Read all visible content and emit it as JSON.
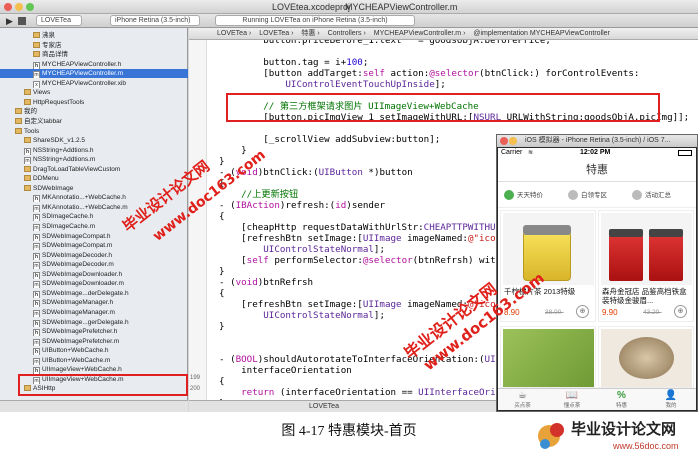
{
  "xcode": {
    "tab_project": "LOVETea",
    "scheme_device": "iPhone Retina (3.5-inch)",
    "status_text": "Running LOVETea on iPhone Retina (3.5-inch)",
    "window_title_1": "LOVEtea.xcodeproj",
    "window_title_2": "MYCHEAPViewController.m",
    "breadcrumb": [
      "LOVETea",
      "LOVETea",
      "特惠",
      "Controllers",
      "MYCHEAPViewController.m",
      "@implementation MYCHEAPViewController"
    ],
    "status_bar_label": "LOVETea"
  },
  "navigator": {
    "items": [
      {
        "label": "沸泉",
        "type": "folder",
        "indent": 3
      },
      {
        "label": "专家店",
        "type": "folder",
        "indent": 3
      },
      {
        "label": "商品详情",
        "type": "folder",
        "indent": 3
      },
      {
        "label": "MYCHEAPViewController.h",
        "type": "h",
        "indent": 3
      },
      {
        "label": "MYCHEAPViewController.m",
        "type": "m",
        "indent": 3,
        "selected": true
      },
      {
        "label": "MYCHEAPViewController.xib",
        "type": "x",
        "indent": 3
      },
      {
        "label": "Views",
        "type": "folder",
        "indent": 2
      },
      {
        "label": "HttpRequestTools",
        "type": "folder",
        "indent": 2
      },
      {
        "label": "我的",
        "type": "folder",
        "indent": 1
      },
      {
        "label": "自定义tabbar",
        "type": "folder",
        "indent": 1
      },
      {
        "label": "Tools",
        "type": "folder",
        "indent": 1
      },
      {
        "label": "ShareSDK_v1.2.5",
        "type": "folder",
        "indent": 2
      },
      {
        "label": "NSString+Addtions.h",
        "type": "h",
        "indent": 2
      },
      {
        "label": "NSString+Addtions.m",
        "type": "m",
        "indent": 2
      },
      {
        "label": "DragToLoadTableViewCustom",
        "type": "folder",
        "indent": 2
      },
      {
        "label": "DDMenu",
        "type": "folder",
        "indent": 2
      },
      {
        "label": "SDWebImage",
        "type": "folder",
        "indent": 2
      },
      {
        "label": "MKAnnotatio...+WebCache.h",
        "type": "h",
        "indent": 3
      },
      {
        "label": "MKAnnotatio...+WebCache.m",
        "type": "m",
        "indent": 3
      },
      {
        "label": "SDImageCache.h",
        "type": "h",
        "indent": 3
      },
      {
        "label": "SDImageCache.m",
        "type": "m",
        "indent": 3
      },
      {
        "label": "SDWebImageCompat.h",
        "type": "h",
        "indent": 3
      },
      {
        "label": "SDWebImageCompat.m",
        "type": "m",
        "indent": 3
      },
      {
        "label": "SDWebImageDecoder.h",
        "type": "h",
        "indent": 3
      },
      {
        "label": "SDWebImageDecoder.m",
        "type": "m",
        "indent": 3
      },
      {
        "label": "SDWebImageDownloader.h",
        "type": "h",
        "indent": 3
      },
      {
        "label": "SDWebImageDownloader.m",
        "type": "m",
        "indent": 3
      },
      {
        "label": "SDWebImage...derDelegate.h",
        "type": "h",
        "indent": 3
      },
      {
        "label": "SDWebImageManager.h",
        "type": "h",
        "indent": 3
      },
      {
        "label": "SDWebImageManager.m",
        "type": "m",
        "indent": 3
      },
      {
        "label": "SDWebImage...gerDelegate.h",
        "type": "h",
        "indent": 3
      },
      {
        "label": "SDWebImagePrefetcher.h",
        "type": "h",
        "indent": 3
      },
      {
        "label": "SDWebImagePrefetcher.m",
        "type": "m",
        "indent": 3
      },
      {
        "label": "UIButton+WebCache.h",
        "type": "h",
        "indent": 3
      },
      {
        "label": "UIButton+WebCache.m",
        "type": "m",
        "indent": 3
      },
      {
        "label": "UIImageView+WebCache.h",
        "type": "h",
        "indent": 3
      },
      {
        "label": "UIImageView+WebCache.m",
        "type": "m",
        "indent": 3
      },
      {
        "label": "ASIHttp",
        "type": "folder",
        "indent": 2
      }
    ]
  },
  "code": {
    "lines": [
      {
        "n": "",
        "t": "        button.priceBefore_1.text   = goodsObjA.beforePrice;"
      },
      {
        "n": "",
        "t": ""
      },
      {
        "n": "",
        "t": "        button.tag = i+100;"
      },
      {
        "n": "",
        "t": "        [button addTarget:self action:@selector(btnClick:) forControlEvents:"
      },
      {
        "n": "",
        "t": "            UIControlEventTouchUpInside];"
      },
      {
        "n": "",
        "t": ""
      },
      {
        "n": "",
        "t": "        // 第三方框架请求图片 UIImageView+WebCache"
      },
      {
        "n": "",
        "t": "        [button.picImgView_1 setImageWithURL:[NSURL URLWithString:goodsObjA.picImg]];"
      },
      {
        "n": "",
        "t": ""
      },
      {
        "n": "",
        "t": "        [_scrollView addSubview:button];"
      },
      {
        "n": "",
        "t": "    }"
      },
      {
        "n": "",
        "t": "}"
      },
      {
        "n": "",
        "t": "- (void)btnClick:(UIButton *)button"
      },
      {
        "n": "",
        "t": "{"
      },
      {
        "n": "",
        "t": "    //上更新按钮"
      },
      {
        "n": "",
        "t": "- (IBAction)refresh:(id)sender"
      },
      {
        "n": "",
        "t": "{"
      },
      {
        "n": "",
        "t": "    [cheapHttp requestDataWithUrlStr:CHEAPTTPWITHURL];"
      },
      {
        "n": "",
        "t": "    [refreshBtn setImage:[UIImage imageNamed:@\"icon_update_nor\"] forState:"
      },
      {
        "n": "",
        "t": "        UIControlStateNormal];"
      },
      {
        "n": "",
        "t": "    [self performSelector:@selector(btnRefrsh) withObject:nil afterDelay:1];"
      },
      {
        "n": "",
        "t": "}"
      },
      {
        "n": "",
        "t": "- (void)btnRefrsh"
      },
      {
        "n": "",
        "t": "{"
      },
      {
        "n": "",
        "t": "    [refreshBtn setImage:[UIImage imageNamed:@\"icon_update\"] forState:"
      },
      {
        "n": "",
        "t": "        UIControlStateNormal];"
      },
      {
        "n": "",
        "t": "}"
      },
      {
        "n": "",
        "t": ""
      },
      {
        "n": "",
        "t": ""
      },
      {
        "n": "",
        "t": "- (BOOL)shouldAutorotateToInterfaceOrientation:(UIInterfaceOrientation)"
      },
      {
        "n": "",
        "t": "    interfaceOrientation"
      },
      {
        "n": "",
        "t": "{"
      },
      {
        "n": "",
        "t": "    return (interfaceOrientation == UIInterfaceOrientationPortrait);"
      },
      {
        "n": "",
        "t": "}"
      }
    ],
    "line_numbers": [
      "199",
      "200"
    ]
  },
  "simulator": {
    "window_title": "iOS 模拟器 - iPhone Retina (3.5-inch) / iOS 7...",
    "carrier": "Carrier",
    "time": "12:02 PM",
    "nav_title": "特惠",
    "tabs": [
      {
        "label": "天天特价",
        "color": "#4caf50"
      },
      {
        "label": "白领专区",
        "color": "#bbbbbb"
      },
      {
        "label": "活动汇总",
        "color": "#bbbbbb"
      }
    ],
    "products": [
      {
        "title": "千柠檬片茶 2013特级",
        "price": "8.90",
        "old": "38.00-"
      },
      {
        "title": "森舟金冠店 品鉴高档铁盒装特级金骏眉...",
        "price": "9.90",
        "old": "43.20-"
      }
    ],
    "tabbar": [
      {
        "label": "买点茶",
        "icon": "☕"
      },
      {
        "label": "懂点茶",
        "icon": "📖"
      },
      {
        "label": "特惠",
        "icon": "%"
      },
      {
        "label": "我的",
        "icon": "👤"
      }
    ]
  },
  "caption": "图  4-17    特惠模块-首页",
  "watermarks": {
    "text_a": "毕业设计论文网",
    "text_b": "www.doc163.com",
    "logo_cn": "毕业设计论文网",
    "logo_url": "www.56doc.com"
  }
}
